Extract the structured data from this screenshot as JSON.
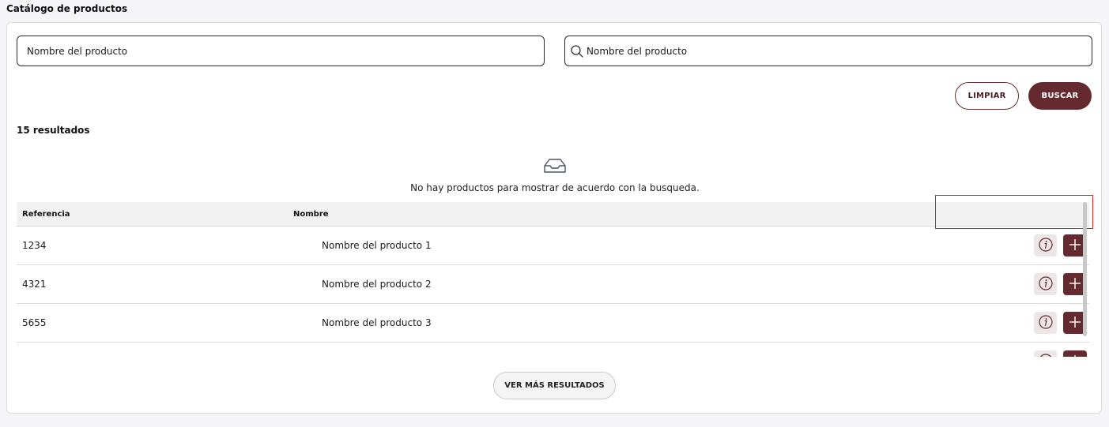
{
  "page": {
    "title": "Catálogo de productos"
  },
  "search": {
    "name_placeholder": "Nombre del producto",
    "query_placeholder": "Nombre del producto",
    "clear_label": "LIMPIAR",
    "search_label": "BUSCAR"
  },
  "results": {
    "count_label": "15 resultados",
    "empty_message": "No hay productos para mostrar de acuerdo con la busqueda.",
    "more_label": "VER MÁS RESULTADOS"
  },
  "table": {
    "columns": {
      "reference": "Referencia",
      "name": "Nombre"
    },
    "rows": [
      {
        "reference": "1234",
        "name": "Nombre del producto 1"
      },
      {
        "reference": "4321",
        "name": "Nombre del producto 2"
      },
      {
        "reference": "5655",
        "name": "Nombre del producto 3"
      },
      {
        "reference": "",
        "name": ""
      }
    ]
  },
  "icons": {
    "search": "search-icon",
    "empty": "inbox-icon",
    "info": "info-icon",
    "add": "plus-icon"
  },
  "colors": {
    "primary": "#652a2f",
    "info_bg": "#ece6e6",
    "highlight": "#e02020"
  }
}
